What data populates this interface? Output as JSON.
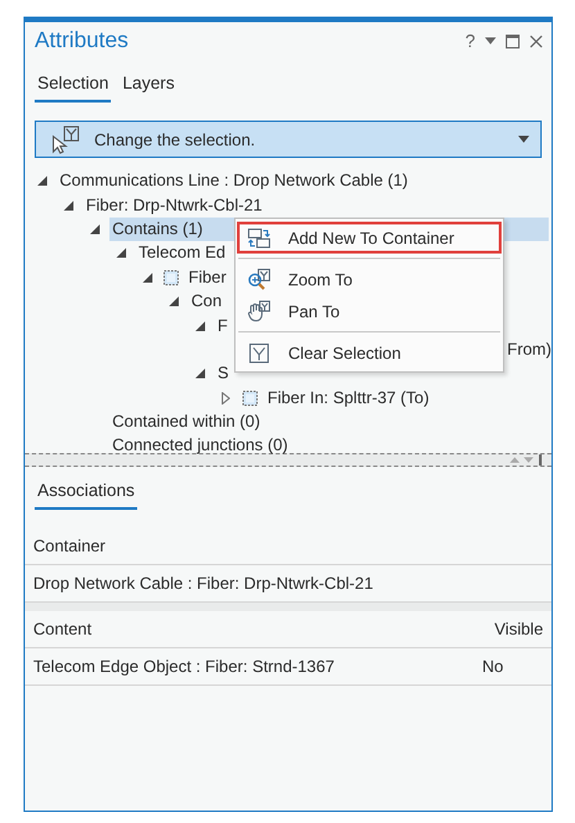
{
  "window": {
    "title": "Attributes",
    "help": "?"
  },
  "tabs": [
    {
      "label": "Selection",
      "selected": true
    },
    {
      "label": "Layers",
      "selected": false
    }
  ],
  "selection_dropdown": {
    "label": "Change the selection."
  },
  "tree": [
    {
      "label": "Communications Line : Drop Network Cable (1)",
      "kind": "label",
      "expanded": true,
      "selected": false,
      "children": [
        {
          "label": "Fiber: Drp-Ntwrk-Cbl-21",
          "kind": "label",
          "expanded": true,
          "selected": false,
          "children": [
            {
              "label": "Contains (1)",
              "kind": "label",
              "expanded": true,
              "selected": true,
              "children": [
                {
                  "label": "Telecom Ed",
                  "kind": "label",
                  "expanded": true,
                  "selected": false,
                  "children": [
                    {
                      "label": "Fiber",
                      "kind": "record",
                      "expanded": true,
                      "selected": false,
                      "children": [
                        {
                          "label": "Con",
                          "kind": "label",
                          "expanded": true,
                          "selected": false,
                          "children": [
                            {
                              "label": "F",
                              "kind": "label",
                              "expanded": true,
                              "selected": false,
                              "children": [
                                {
                                  "label": "From)",
                                  "kind": "covered",
                                  "selected": false
                                }
                              ]
                            },
                            {
                              "label": "S",
                              "kind": "label",
                              "expanded": true,
                              "selected": false,
                              "children": [
                                {
                                  "label": "Fiber In: Splttr-37 (To)",
                                  "kind": "record",
                                  "expanded": false,
                                  "selected": false
                                }
                              ]
                            }
                          ]
                        }
                      ]
                    }
                  ]
                }
              ]
            },
            {
              "label": "Contained within (0)",
              "kind": "label",
              "selected": false
            },
            {
              "label": "Connected junctions (0)",
              "kind": "label",
              "selected": false
            }
          ]
        }
      ]
    }
  ],
  "context_menu": [
    {
      "kind": "item",
      "label": "Add New To Container",
      "highlighted": true
    },
    {
      "kind": "separator"
    },
    {
      "kind": "item",
      "label": "Zoom To",
      "highlighted": false
    },
    {
      "kind": "item",
      "label": "Pan To",
      "highlighted": false
    },
    {
      "kind": "separator"
    },
    {
      "kind": "item",
      "label": "Clear Selection",
      "highlighted": false
    }
  ],
  "details_tabs": [
    {
      "label": "Associations",
      "selected": true
    }
  ],
  "container_table": {
    "columns": [
      "Container"
    ],
    "rows": [
      [
        "Drop Network Cable : Fiber: Drp-Ntwrk-Cbl-21"
      ]
    ]
  },
  "content_table": {
    "columns": [
      "Content",
      "Visible"
    ],
    "rows": [
      [
        "Telecom Edge Object : Fiber: Strnd-1367",
        "No"
      ]
    ]
  }
}
